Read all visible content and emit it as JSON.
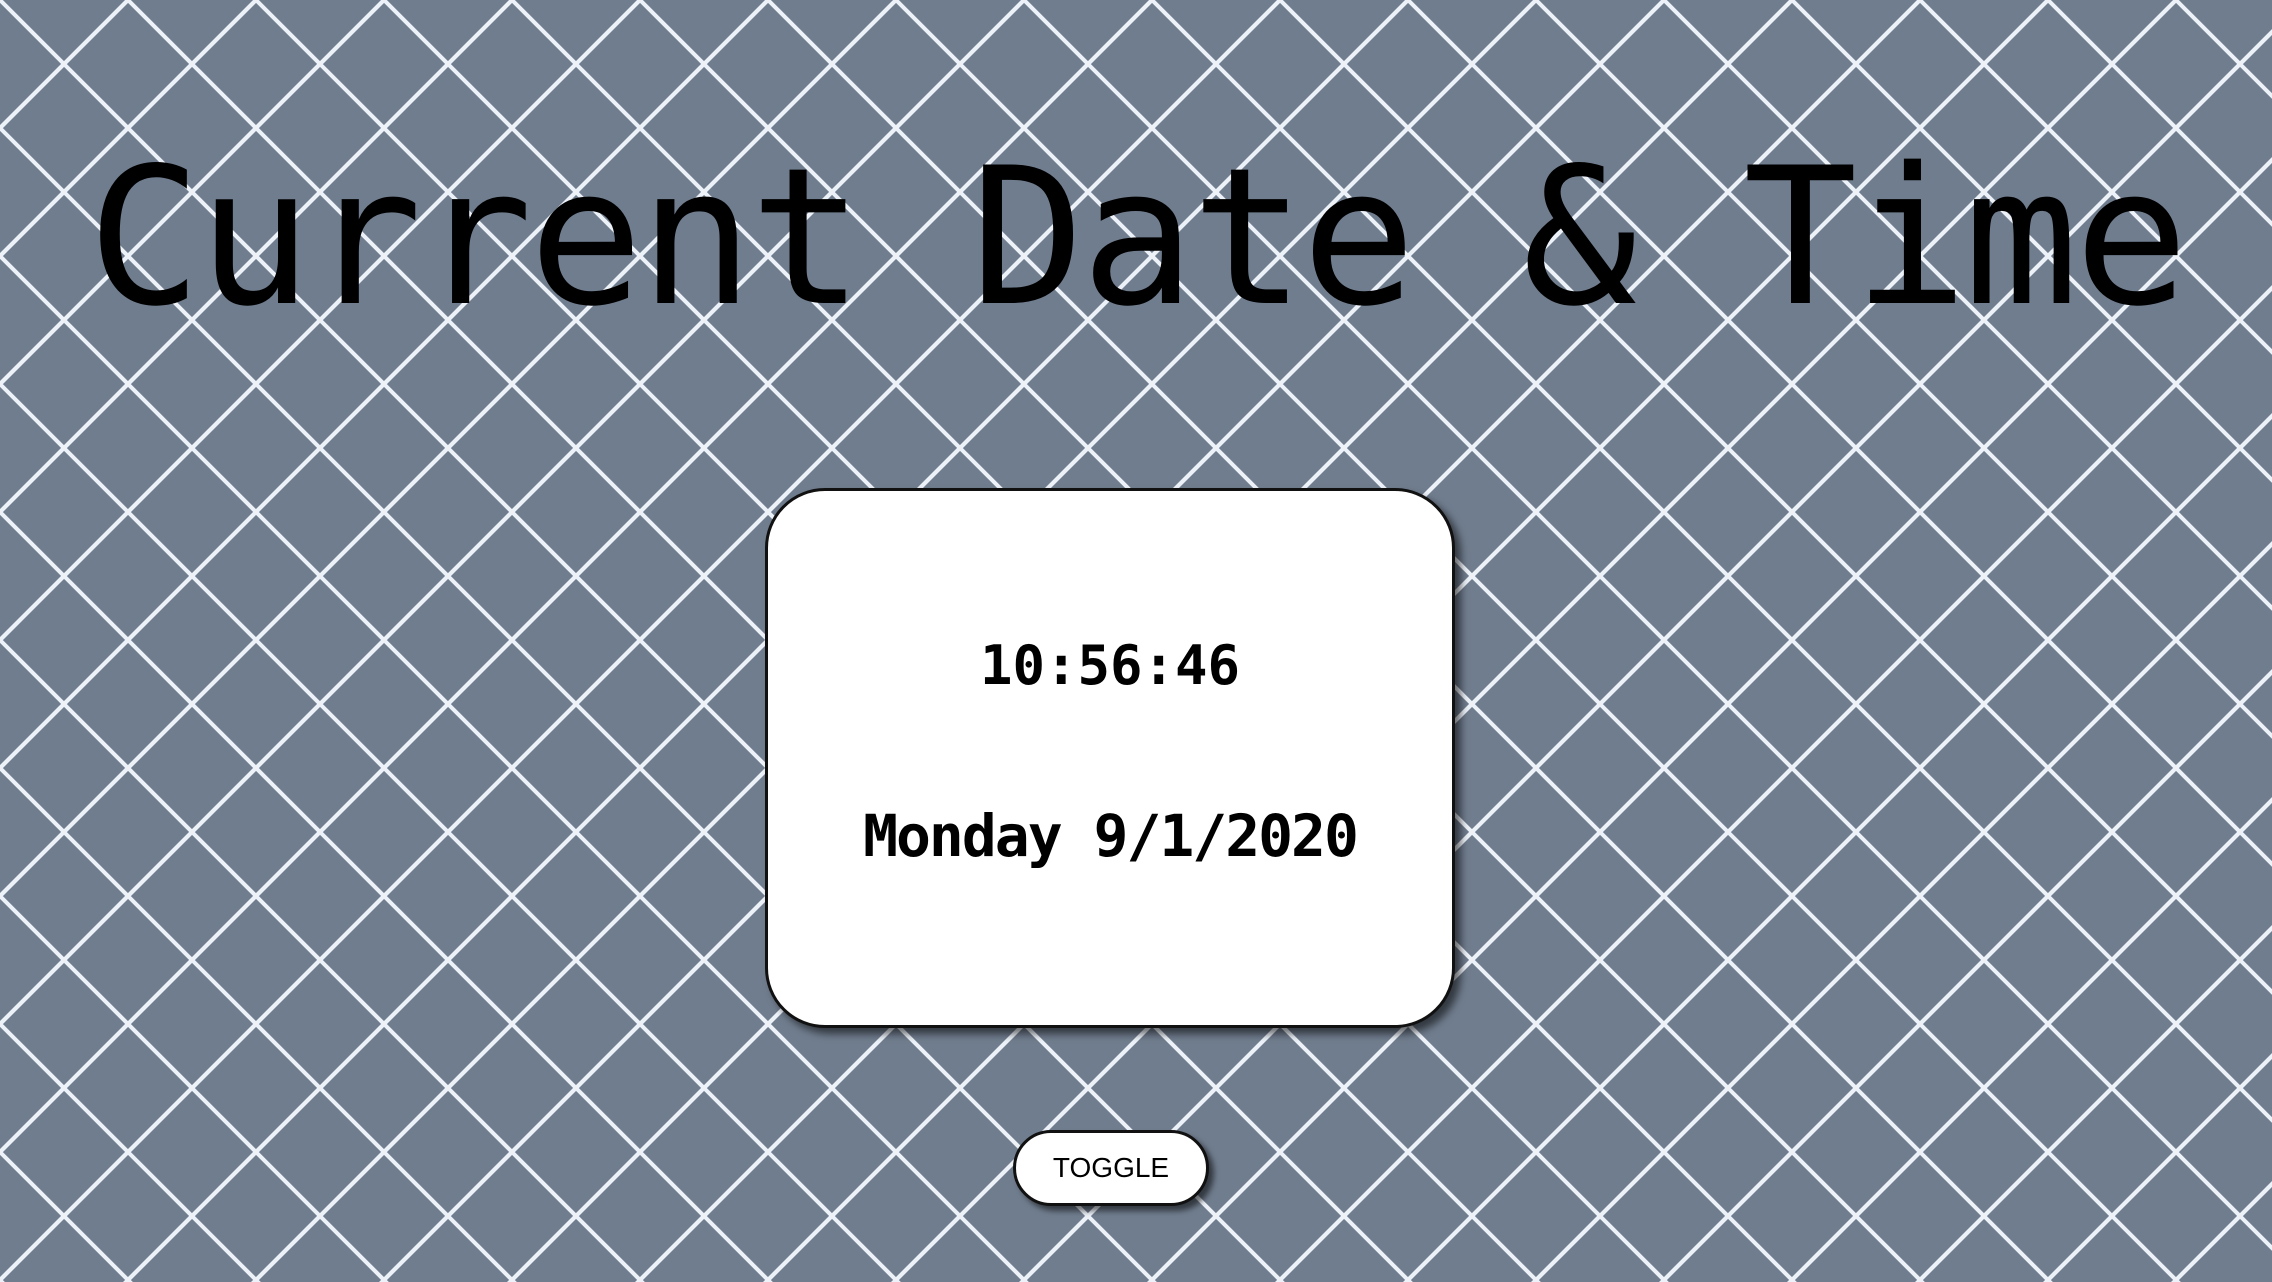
{
  "page": {
    "title": "Current Date & Time",
    "background_color": "#707d8e",
    "pattern_line_color": "#ffffff"
  },
  "clock": {
    "time": "10:56:46",
    "date": "Monday 9/1/2020"
  },
  "controls": {
    "toggle_label": "TOGGLE"
  }
}
